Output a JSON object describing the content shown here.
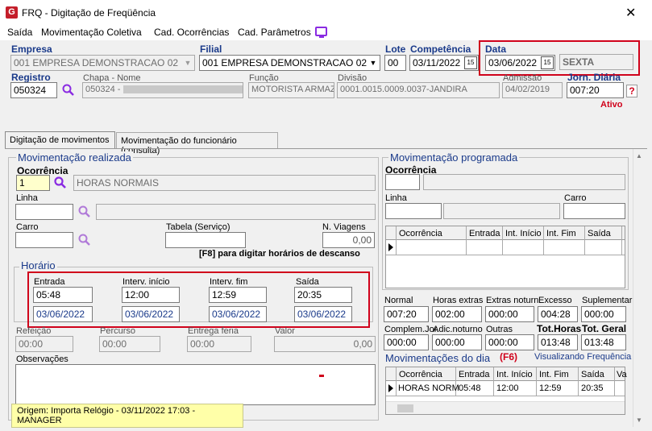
{
  "window": {
    "title": "FRQ - Digitação de Freqüência",
    "icon": "G",
    "close": "✕"
  },
  "menu": [
    "Saída",
    "Movimentação Coletiva",
    "Cad. Ocorrências",
    "Cad. Parâmetros"
  ],
  "header": {
    "empresa_label": "Empresa",
    "empresa_value": "001 EMPRESA DEMONSTRACAO 02",
    "filial_label": "Filial",
    "filial_value": "001 EMPRESA DEMONSTRACAO 02",
    "lote_label": "Lote",
    "lote_value": "00",
    "competencia_label": "Competência",
    "competencia_value": "03/11/2022",
    "data_label": "Data",
    "data_value": "03/06/2022",
    "dia_semana": "SEXTA",
    "registro_label": "Registro",
    "registro_value": "050324",
    "chapa_nome_label": "Chapa - Nome",
    "chapa_value": "050324 -",
    "funcao_label": "Função",
    "funcao_value": "MOTORISTA ARMAZ",
    "divisao_label": "Divisão",
    "divisao_value": "0001.0015.0009.0037-JANDIRA",
    "admissao_label": "Admissão",
    "admissao_value": "04/02/2019",
    "jorn_label": "Jorn. Diária",
    "jorn_value": "007:20",
    "help": "?",
    "status": "Ativo"
  },
  "tabs": [
    "Digitação de movimentos",
    "Movimentação do funcionário (consulta)"
  ],
  "realizada": {
    "title": "Movimentação realizada",
    "ocorrencia_label": "Ocorrência",
    "ocorrencia_code": "1",
    "ocorrencia_desc": "HORAS NORMAIS",
    "linha_label": "Linha",
    "carro_label": "Carro",
    "tabela_label": "Tabela (Serviço)",
    "viagens_label": "N. Viagens",
    "viagens_value": "0,00",
    "f8_hint": "[F8] para digitar horários de descanso"
  },
  "horario": {
    "title": "Horário",
    "entrada_label": "Entrada",
    "entrada": "05:48",
    "entrada_data": "03/06/2022",
    "ini_label": "Interv. início",
    "ini": "12:00",
    "ini_data": "03/06/2022",
    "fim_label": "Interv. fim",
    "fim": "12:59",
    "fim_data": "03/06/2022",
    "saida_label": "Saída",
    "saida": "20:35",
    "saida_data": "03/06/2022"
  },
  "extras": {
    "refeicao_label": "Refeição",
    "refeicao": "00:00",
    "percurso_label": "Percurso",
    "percurso": "00:00",
    "entrega_label": "Entrega feria",
    "entrega": "00:00",
    "valor_label": "Valor",
    "valor": "0,00",
    "obs_label": "Observações"
  },
  "origem_tooltip": "Origem: Importa Relógio - 03/11/2022 17:03 - MANAGER",
  "programada": {
    "title": "Movimentação programada",
    "ocorrencia_label": "Ocorrência",
    "linha_label": "Linha",
    "carro_label": "Carro",
    "columns": [
      "Ocorrência",
      "Entrada",
      "Int. Início",
      "Int. Fim",
      "Saída"
    ]
  },
  "totais": {
    "labels1": [
      "Normal",
      "Horas extras",
      "Extras noturn.",
      "Excesso",
      "Suplementar"
    ],
    "values1": [
      "007:20",
      "002:00",
      "000:00",
      "004:28",
      "000:00"
    ],
    "labels2": [
      "Complem.Jor.",
      "Adic.noturno",
      "Outras",
      "Tot.Horas",
      "Tot. Geral"
    ],
    "values2": [
      "000:00",
      "000:00",
      "000:00",
      "013:48",
      "013:48"
    ]
  },
  "dia": {
    "title": "Movimentações do dia",
    "f6": "(F6)",
    "visualizando": "Visualizando Frequência",
    "columns": [
      "Ocorrência",
      "Entrada",
      "Int. Início",
      "Int. Fim",
      "Saída",
      "Va"
    ],
    "row": [
      "HORAS NORM",
      "05:48",
      "12:00",
      "12:59",
      "20:35",
      ""
    ]
  },
  "colors": {
    "accent": "#1a3a8a",
    "highlight": "#d0021b",
    "status": "#d0021b"
  }
}
